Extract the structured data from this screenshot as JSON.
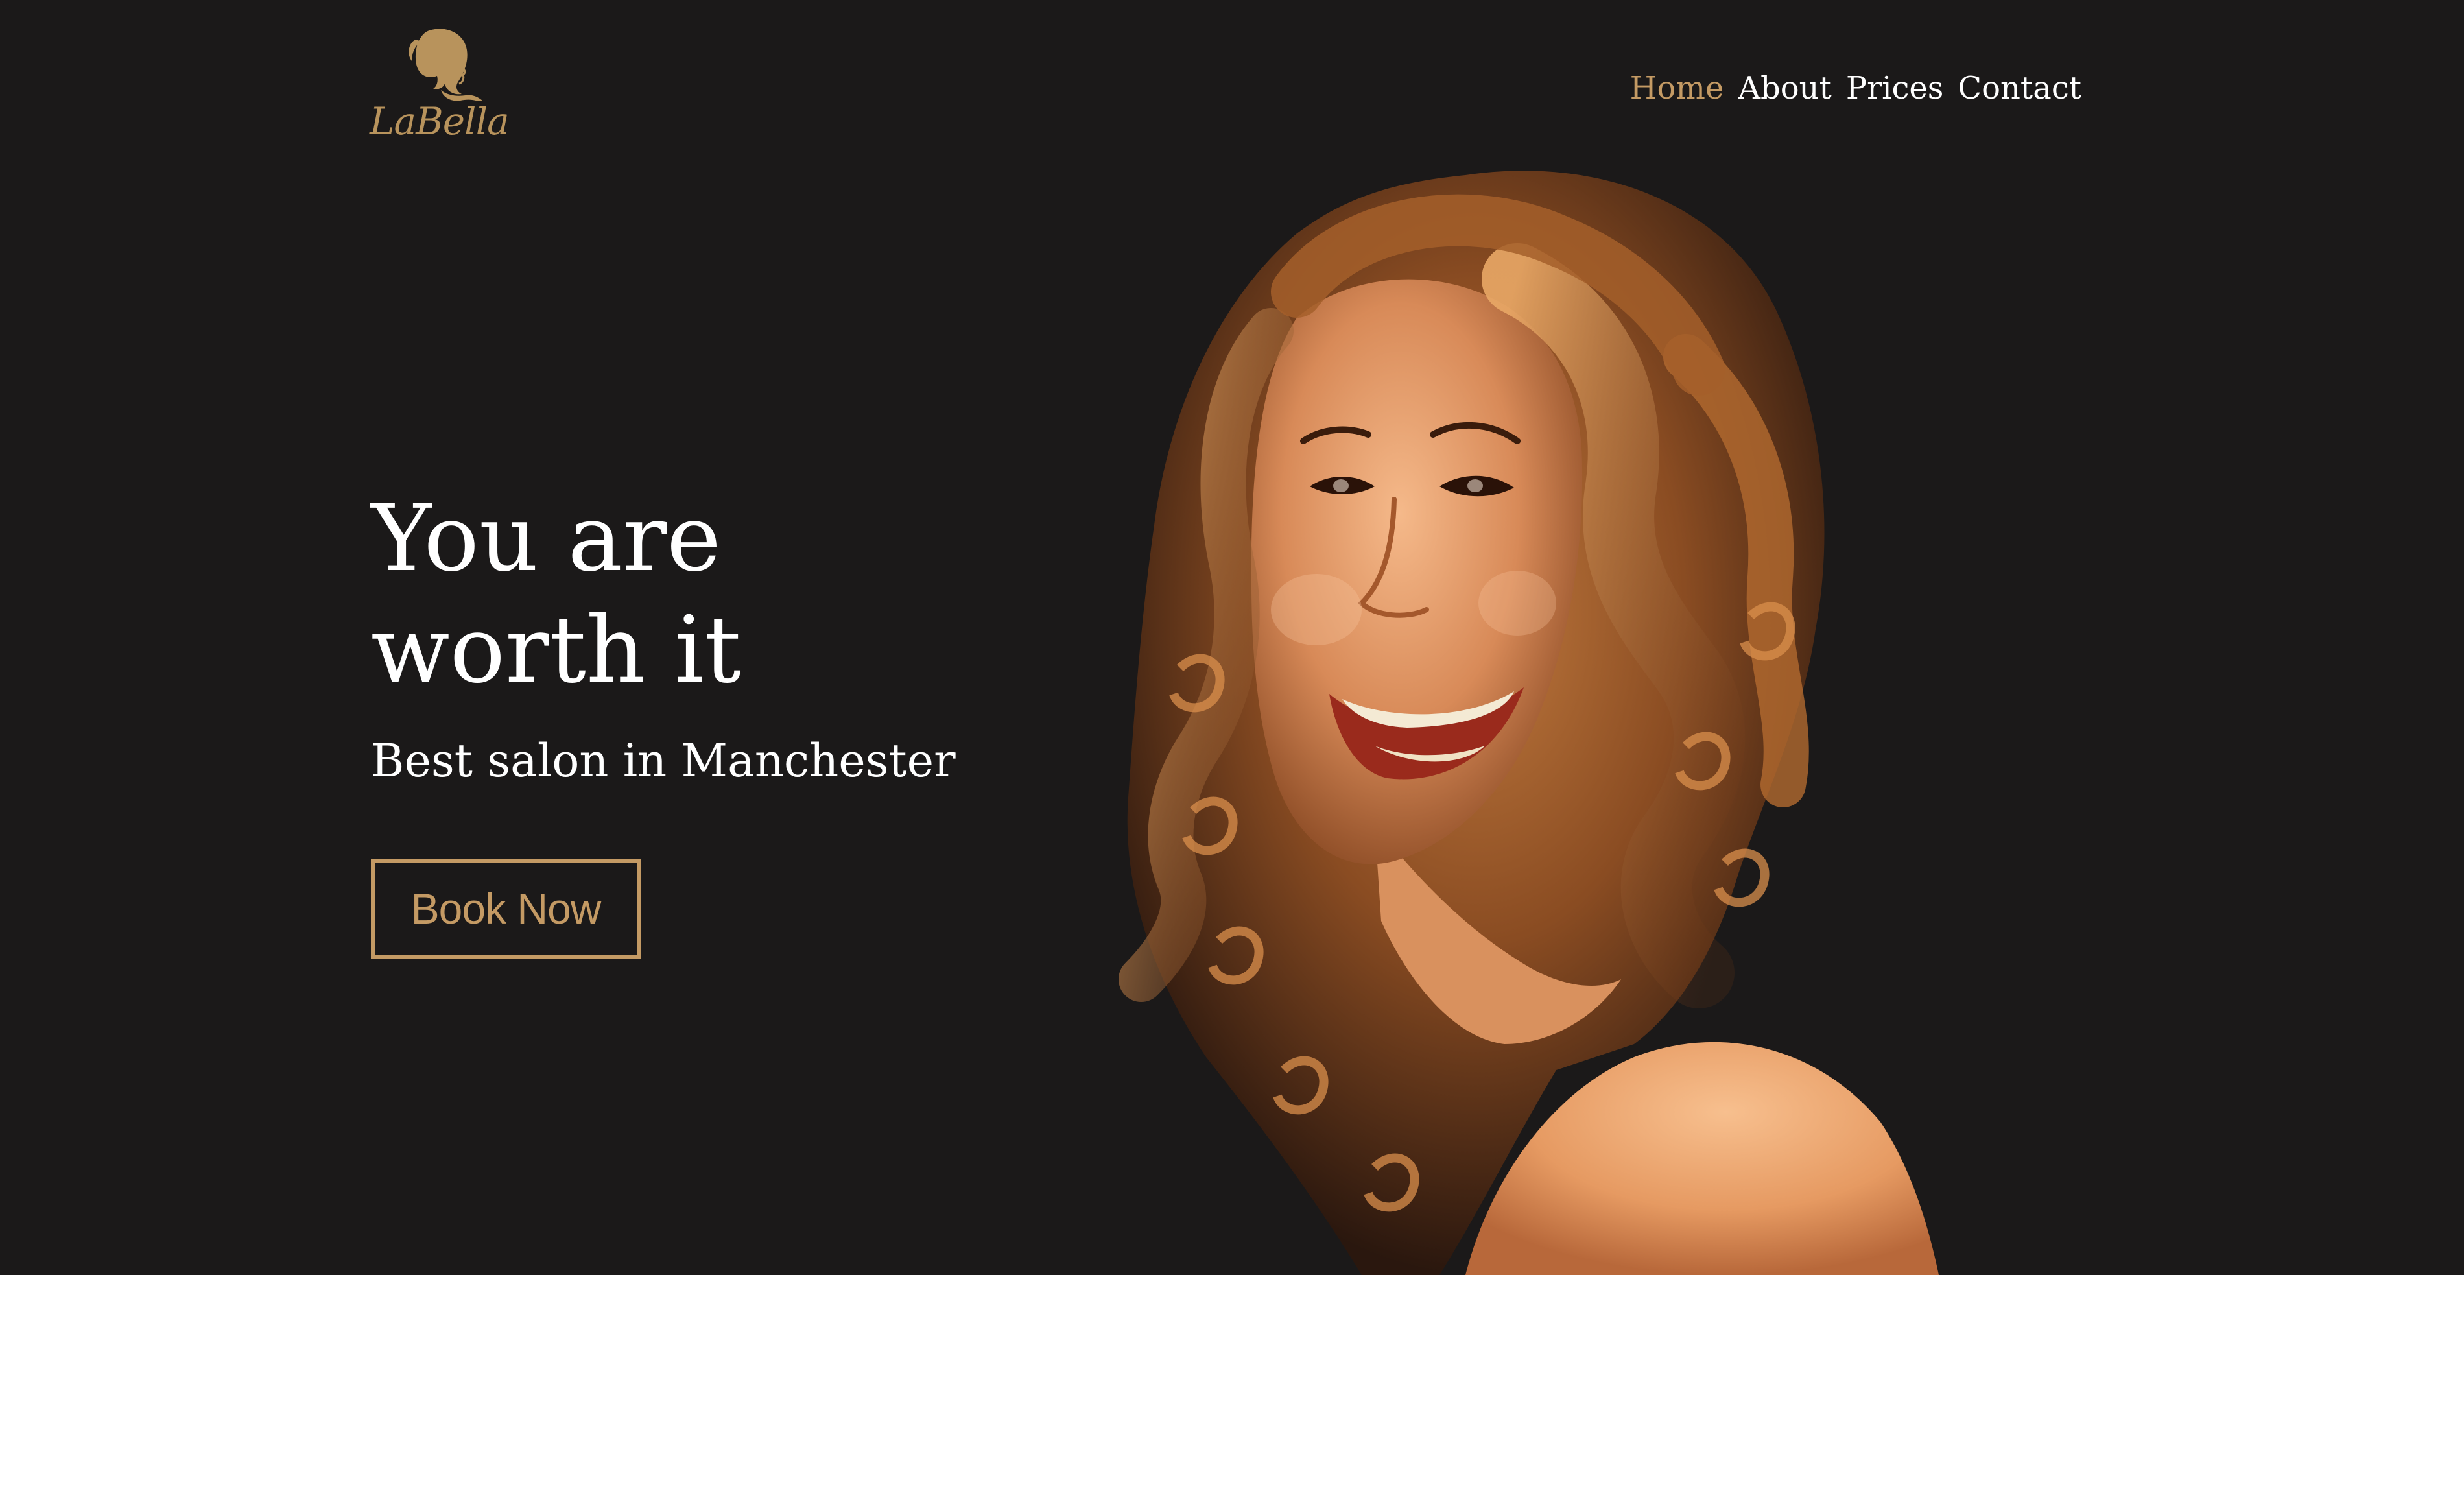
{
  "brand": {
    "name": "LaBella",
    "logo_icon": "woman-silhouette-icon",
    "accent_color": "#c49a64"
  },
  "nav": {
    "items": [
      {
        "label": "Home",
        "active": true
      },
      {
        "label": "About",
        "active": false
      },
      {
        "label": "Prices",
        "active": false
      },
      {
        "label": "Contact",
        "active": false
      }
    ]
  },
  "hero": {
    "headline_line1": "You are",
    "headline_line2": "worth it",
    "subheadline": "Best salon in Manchester",
    "cta_label": "Book Now",
    "background_color": "#1b1919"
  }
}
